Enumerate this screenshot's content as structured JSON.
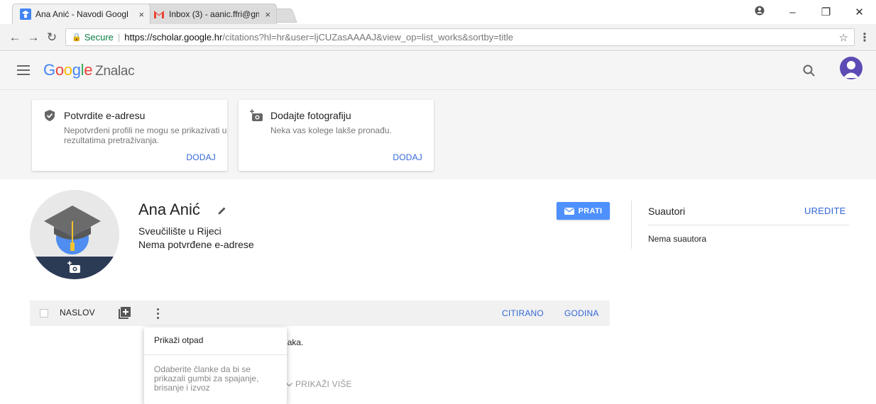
{
  "browser": {
    "tabs": [
      {
        "title": "Ana Anić - Navodi Googl",
        "favicon": "scholar-icon",
        "close": "×"
      },
      {
        "title": "Inbox (3) - aanic.ffri@gm",
        "favicon": "gmail-icon",
        "close": "×"
      }
    ],
    "address": {
      "secure_label": "Secure",
      "url_host": "https://scholar.google.hr",
      "url_rest": "/citations?hl=hr&user=ljCUZasAAAAJ&view_op=list_works&sortby=title"
    }
  },
  "header": {
    "logo": {
      "g": "G",
      "o1": "o",
      "o2": "o",
      "g2": "g",
      "l": "l",
      "e": "e",
      "product": "Znalac"
    }
  },
  "notices": [
    {
      "title": "Potvrdite e-adresu",
      "desc": "Nepotvrđeni profili ne mogu se prikazivati u rezultatima pretraživanja.",
      "action": "DODAJ",
      "icon": "shield-check-icon"
    },
    {
      "title": "Dodajte fotografiju",
      "desc": "Neka vas kolege lakše pronađu.",
      "action": "DODAJ",
      "icon": "add-photo-icon"
    }
  ],
  "profile": {
    "name": "Ana Anić",
    "affiliation": "Sveučilište u Rijeci",
    "email_status": "Nema potvrđene e-adrese",
    "follow_label": "PRATI"
  },
  "coauthors": {
    "title": "Suautori",
    "edit_label": "UREDITE",
    "empty": "Nema suautora"
  },
  "articles": {
    "col_title": "NASLOV",
    "col_cited": "CITIRANO",
    "col_year": "GODINA",
    "empty": "m profilu nema članaka.",
    "show_more": "PRIKAŽI VIŠE"
  },
  "menu": {
    "item": "Prikaži otpad",
    "hint": "Odaberite članke da bi se prikazali gumbi za spajanje, brisanje i izvoz"
  },
  "colors": {
    "accent": "#3367d6",
    "follow": "#4d90fe",
    "avatar": "#5d4bb5"
  }
}
